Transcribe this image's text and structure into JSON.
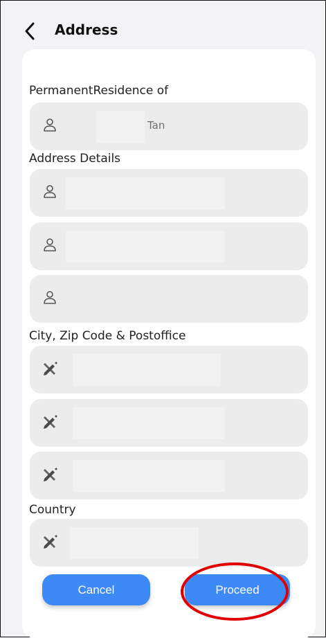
{
  "header": {
    "back_icon": "chevron-left-icon",
    "title": "Address"
  },
  "sections": {
    "residence": "PermanentResidence of",
    "address_details": "Address Details",
    "city_zip_postoffice": "City, Zip Code & Postoffice",
    "country": "Country"
  },
  "fields": {
    "residence": {
      "icon": "person-icon",
      "value": "Tan"
    },
    "address_1": {
      "icon": "person-icon",
      "value": ""
    },
    "address_2": {
      "icon": "person-icon",
      "value": ""
    },
    "address_3": {
      "icon": "person-icon",
      "value": ""
    },
    "city": {
      "icon": "pen-ruler-icon",
      "value": ""
    },
    "zip": {
      "icon": "pen-ruler-icon",
      "value": ""
    },
    "postoffice": {
      "icon": "pen-ruler-icon",
      "value": ""
    },
    "country": {
      "icon": "pen-ruler-icon",
      "value": ""
    }
  },
  "buttons": {
    "cancel": "Cancel",
    "proceed": "Proceed"
  },
  "colors": {
    "accent": "#3d89f5",
    "highlight_ring": "#e00000",
    "field_bg": "#ececec"
  }
}
